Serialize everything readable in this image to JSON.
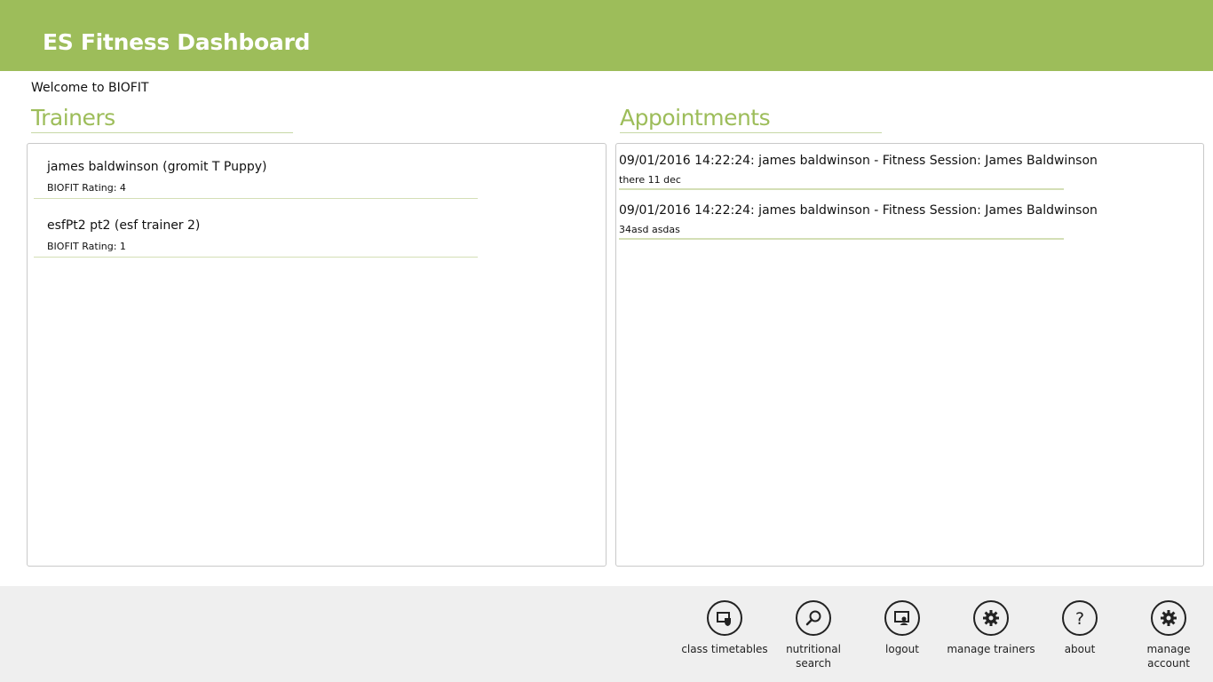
{
  "header": {
    "title": "ES Fitness Dashboard"
  },
  "welcome": "Welcome to BIOFIT",
  "trainers": {
    "title": "Trainers",
    "items": [
      {
        "name": "james baldwinson (gromit T Puppy)",
        "rating": "BIOFIT Rating: 4"
      },
      {
        "name": "esfPt2 pt2 (esf trainer 2)",
        "rating": "BIOFIT Rating: 1"
      }
    ]
  },
  "appointments": {
    "title": "Appointments",
    "items": [
      {
        "summary": "09/01/2016 14:22:24: james baldwinson - Fitness Session: James Baldwinson",
        "note": "there 11 dec"
      },
      {
        "summary": "09/01/2016 14:22:24: james baldwinson - Fitness Session: James Baldwinson",
        "note": "34asd asdas"
      }
    ]
  },
  "appbar": {
    "buttons": [
      {
        "label": "class timetables",
        "icon": "calendar-shield-icon"
      },
      {
        "label": "nutritional search",
        "icon": "search-icon"
      },
      {
        "label": "logout",
        "icon": "user-screen-icon"
      },
      {
        "label": "manage trainers",
        "icon": "gear-icon"
      },
      {
        "label": "about",
        "icon": "question-icon"
      },
      {
        "label": "manage account",
        "icon": "gear-icon"
      }
    ]
  }
}
